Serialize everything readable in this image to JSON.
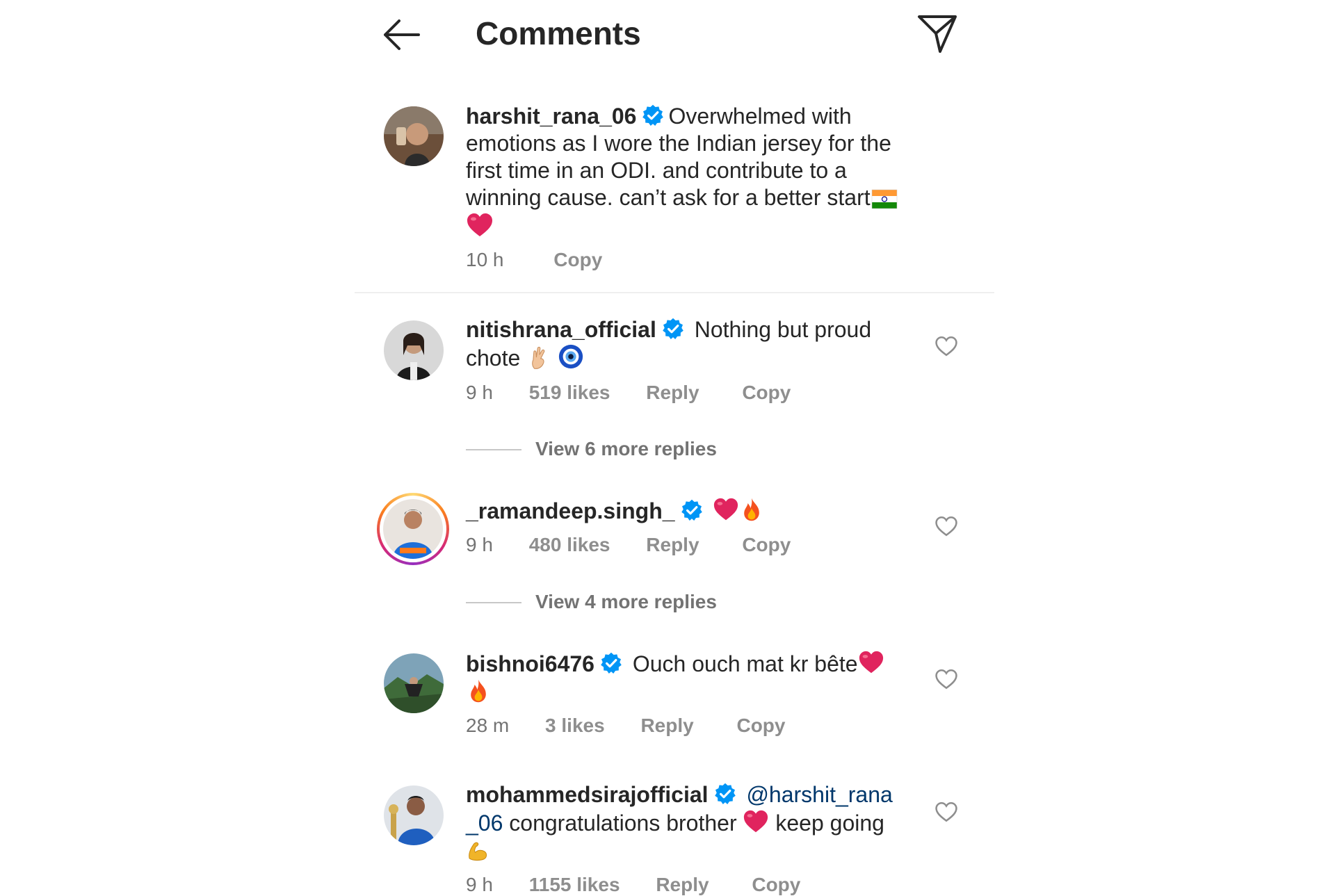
{
  "header": {
    "title": "Comments",
    "back_icon": "arrow-left-icon",
    "send_icon": "paper-plane-icon"
  },
  "caption": {
    "username": "harshit_rana_06",
    "verified": true,
    "text": "Overwhelmed with emotions as I wore the Indian jersey for the first time in an ODI. and contribute to a winning cause. can’t ask for a better start",
    "emoji": [
      "india-flag",
      "red-heart"
    ],
    "time": "10 h",
    "copy_label": "Copy"
  },
  "comments": [
    {
      "username": "nitishrana_official",
      "verified": true,
      "text": "Nothing but proud chote",
      "emoji": [
        "crossed-fingers",
        "nazar-amulet"
      ],
      "time": "9 h",
      "likes": "519 likes",
      "reply_label": "Reply",
      "copy_label": "Copy",
      "view_replies": "View 6 more replies"
    },
    {
      "username": "_ramandeep.singh_",
      "verified": true,
      "text": "",
      "emoji": [
        "red-heart",
        "fire"
      ],
      "time": "9 h",
      "likes": "480 likes",
      "reply_label": "Reply",
      "copy_label": "Copy",
      "view_replies": "View 4 more replies",
      "has_story_ring": true
    },
    {
      "username": "bishnoi6476",
      "verified": true,
      "text": "Ouch ouch mat kr bête",
      "emoji": [
        "red-heart",
        "fire"
      ],
      "time": "28 m",
      "likes": "3 likes",
      "reply_label": "Reply",
      "copy_label": "Copy"
    },
    {
      "username": "mohammedsirajofficial",
      "verified": true,
      "mention": "@harshit_rana_06",
      "mention_part1": "@harshit_rana",
      "mention_part2": "_06",
      "text": "congratulations brother",
      "text_after": "keep going",
      "emoji": [
        "red-heart",
        "flexed-biceps"
      ],
      "time": "9 h",
      "likes": "1155 likes",
      "reply_label": "Reply",
      "copy_label": "Copy"
    }
  ],
  "colors": {
    "text": "#262626",
    "secondary": "#737373",
    "verified": "#0095f6",
    "mention": "#00376b",
    "heart_emoji": "#e0245e"
  }
}
